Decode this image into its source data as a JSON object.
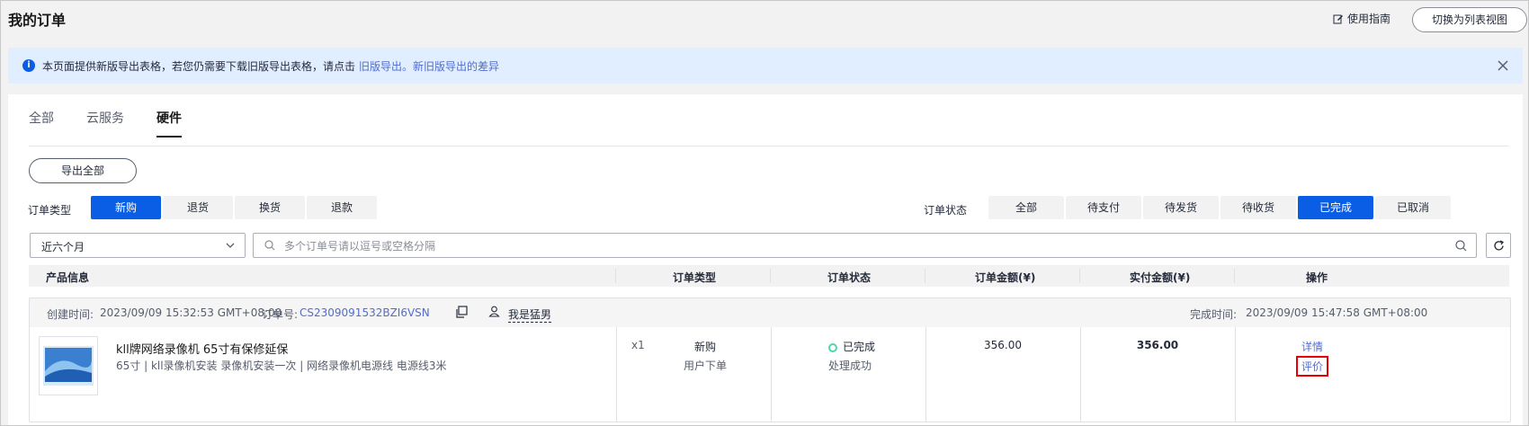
{
  "header": {
    "title": "我的订单",
    "guide_label": "使用指南",
    "switch_label": "切换为列表视图"
  },
  "notice": {
    "text": "本页面提供新版导出表格，若您仍需要下载旧版导出表格，请点击",
    "link_old": "旧版导出。",
    "link_diff": "新旧版导出的差异"
  },
  "tabs": [
    {
      "label": "全部",
      "active": false
    },
    {
      "label": "云服务",
      "active": false
    },
    {
      "label": "硬件",
      "active": true
    }
  ],
  "toolbar": {
    "export_all": "导出全部",
    "order_type_label": "订单类型",
    "order_types": [
      "新购",
      "退货",
      "换货",
      "退款"
    ],
    "order_type_selected": "新购",
    "order_status_label": "订单状态",
    "order_statuses": [
      "全部",
      "待支付",
      "待发货",
      "待收货",
      "已完成",
      "已取消"
    ],
    "order_status_selected": "已完成",
    "period_value": "近六个月",
    "search_placeholder": "多个订单号请以逗号或空格分隔"
  },
  "table": {
    "columns": [
      "产品信息",
      "订单类型",
      "订单状态",
      "订单金额(¥)",
      "实付金额(¥)",
      "操作"
    ]
  },
  "order": {
    "created_label": "创建时间:",
    "created_time": "2023/09/09 15:32:53 GMT+08:00",
    "order_no_label": "订单号:",
    "order_no": "CS2309091532BZI6VSN",
    "buyer": "我是猛男",
    "completed_label": "完成时间:",
    "completed_time": "2023/09/09 15:47:58 GMT+08:00",
    "product_name": "kll牌网络录像机 65寸有保修延保",
    "product_spec": "65寸 | kll录像机安装 录像机安装一次 | 网络录像机电源线 电源线3米",
    "quantity": "x1",
    "type": "新购",
    "type_sub": "用户下单",
    "status": "已完成",
    "status_sub": "处理成功",
    "order_amount": "356.00",
    "paid_amount": "356.00",
    "op_detail": "详情",
    "op_rate": "评价"
  },
  "colors": {
    "primary": "#0a5ee6",
    "link": "#526ecc",
    "success": "#50d4ab",
    "highlight": "#e60000"
  }
}
